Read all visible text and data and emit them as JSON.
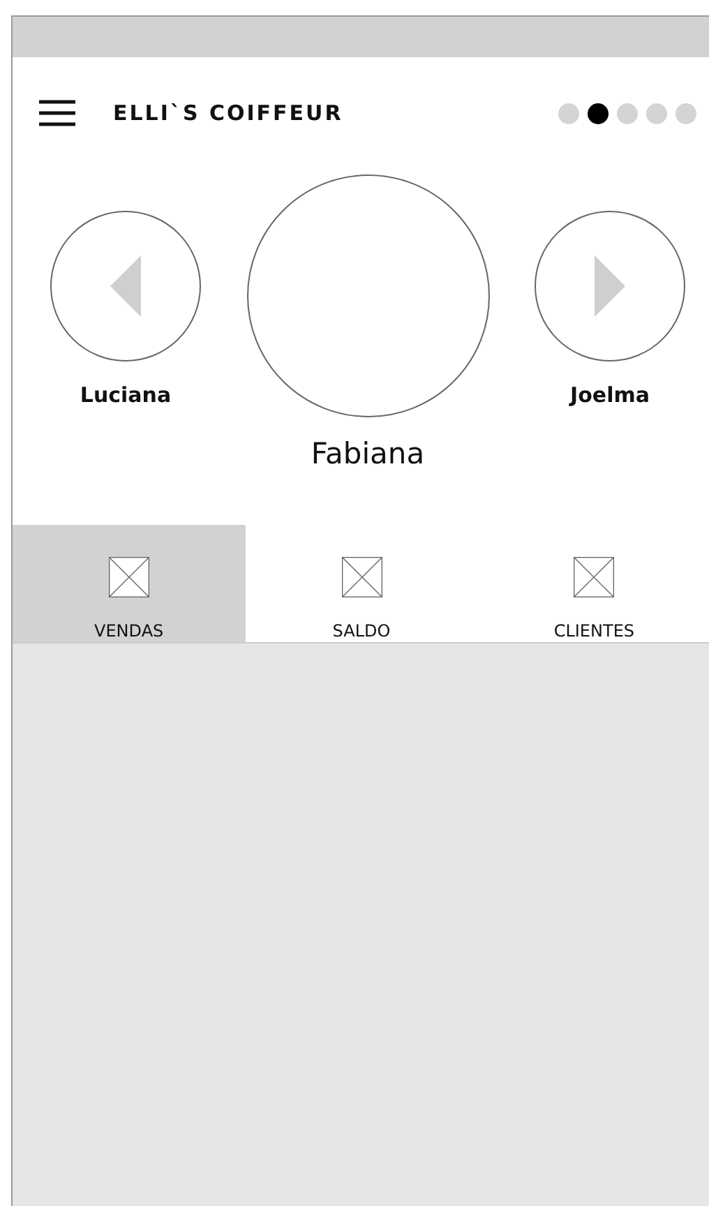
{
  "header": {
    "title": "ELLI`S COIFFEUR"
  },
  "page_dots": [
    {
      "selected": false
    },
    {
      "selected": true
    },
    {
      "selected": false
    },
    {
      "selected": false
    },
    {
      "selected": false
    }
  ],
  "profiles": [
    {
      "name": "Luciana",
      "kind": "previous"
    },
    {
      "name": "Fabiana",
      "kind": "current"
    },
    {
      "name": "Joelma",
      "kind": "next"
    }
  ],
  "tabs": [
    {
      "label": "VENDAS",
      "selected": true
    },
    {
      "label": "SALDO",
      "selected": false
    },
    {
      "label": "CLIENTES",
      "selected": false
    }
  ]
}
